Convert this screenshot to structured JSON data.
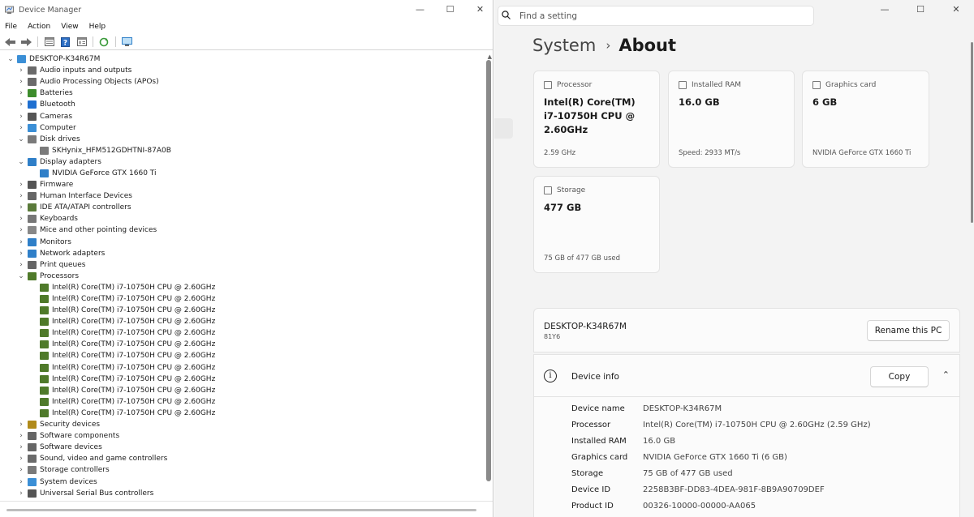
{
  "device_manager": {
    "title": "Device Manager",
    "window_controls": {
      "minimize": "—",
      "maximize": "☐",
      "close": "✕"
    },
    "menu": [
      "File",
      "Action",
      "View",
      "Help"
    ],
    "root": "DESKTOP-K34R67M",
    "tree": [
      {
        "label": "Audio inputs and outputs",
        "expanded": false,
        "icon": "speaker-icon",
        "color": "#6a6a6a"
      },
      {
        "label": "Audio Processing Objects (APOs)",
        "expanded": false,
        "icon": "speaker-icon",
        "color": "#6a6a6a"
      },
      {
        "label": "Batteries",
        "expanded": false,
        "icon": "battery-icon",
        "color": "#3d8c2c"
      },
      {
        "label": "Bluetooth",
        "expanded": false,
        "icon": "bluetooth-icon",
        "color": "#1e6fd0"
      },
      {
        "label": "Cameras",
        "expanded": false,
        "icon": "camera-icon",
        "color": "#555555"
      },
      {
        "label": "Computer",
        "expanded": false,
        "icon": "computer-icon",
        "color": "#3b8fd6"
      },
      {
        "label": "Disk drives",
        "expanded": true,
        "icon": "disk-icon",
        "color": "#7a7a7a",
        "children": [
          {
            "label": "SKHynix_HFM512GDHTNI-87A0B",
            "icon": "disk-icon",
            "color": "#7a7a7a"
          }
        ]
      },
      {
        "label": "Display adapters",
        "expanded": true,
        "icon": "monitor-icon",
        "color": "#2f7fc8",
        "children": [
          {
            "label": "NVIDIA GeForce GTX 1660 Ti",
            "icon": "monitor-icon",
            "color": "#2f7fc8"
          }
        ]
      },
      {
        "label": "Firmware",
        "expanded": false,
        "icon": "chip-icon",
        "color": "#555555"
      },
      {
        "label": "Human Interface Devices",
        "expanded": false,
        "icon": "hid-icon",
        "color": "#666666"
      },
      {
        "label": "IDE ATA/ATAPI controllers",
        "expanded": false,
        "icon": "controller-icon",
        "color": "#5a7a3a"
      },
      {
        "label": "Keyboards",
        "expanded": false,
        "icon": "keyboard-icon",
        "color": "#777777"
      },
      {
        "label": "Mice and other pointing devices",
        "expanded": false,
        "icon": "mouse-icon",
        "color": "#888888"
      },
      {
        "label": "Monitors",
        "expanded": false,
        "icon": "monitor-icon",
        "color": "#2f7fc8"
      },
      {
        "label": "Network adapters",
        "expanded": false,
        "icon": "network-icon",
        "color": "#2f7fc8"
      },
      {
        "label": "Print queues",
        "expanded": false,
        "icon": "printer-icon",
        "color": "#666666"
      },
      {
        "label": "Processors",
        "expanded": true,
        "icon": "processor-icon",
        "color": "#4f7a2a",
        "children": [
          {
            "label": "Intel(R) Core(TM) i7-10750H CPU @ 2.60GHz",
            "icon": "processor-icon",
            "color": "#4f7a2a"
          },
          {
            "label": "Intel(R) Core(TM) i7-10750H CPU @ 2.60GHz",
            "icon": "processor-icon",
            "color": "#4f7a2a"
          },
          {
            "label": "Intel(R) Core(TM) i7-10750H CPU @ 2.60GHz",
            "icon": "processor-icon",
            "color": "#4f7a2a"
          },
          {
            "label": "Intel(R) Core(TM) i7-10750H CPU @ 2.60GHz",
            "icon": "processor-icon",
            "color": "#4f7a2a"
          },
          {
            "label": "Intel(R) Core(TM) i7-10750H CPU @ 2.60GHz",
            "icon": "processor-icon",
            "color": "#4f7a2a"
          },
          {
            "label": "Intel(R) Core(TM) i7-10750H CPU @ 2.60GHz",
            "icon": "processor-icon",
            "color": "#4f7a2a"
          },
          {
            "label": "Intel(R) Core(TM) i7-10750H CPU @ 2.60GHz",
            "icon": "processor-icon",
            "color": "#4f7a2a"
          },
          {
            "label": "Intel(R) Core(TM) i7-10750H CPU @ 2.60GHz",
            "icon": "processor-icon",
            "color": "#4f7a2a"
          },
          {
            "label": "Intel(R) Core(TM) i7-10750H CPU @ 2.60GHz",
            "icon": "processor-icon",
            "color": "#4f7a2a"
          },
          {
            "label": "Intel(R) Core(TM) i7-10750H CPU @ 2.60GHz",
            "icon": "processor-icon",
            "color": "#4f7a2a"
          },
          {
            "label": "Intel(R) Core(TM) i7-10750H CPU @ 2.60GHz",
            "icon": "processor-icon",
            "color": "#4f7a2a"
          },
          {
            "label": "Intel(R) Core(TM) i7-10750H CPU @ 2.60GHz",
            "icon": "processor-icon",
            "color": "#4f7a2a"
          }
        ]
      },
      {
        "label": "Security devices",
        "expanded": false,
        "icon": "security-icon",
        "color": "#b08a1a"
      },
      {
        "label": "Software components",
        "expanded": false,
        "icon": "component-icon",
        "color": "#666666"
      },
      {
        "label": "Software devices",
        "expanded": false,
        "icon": "component-icon",
        "color": "#666666"
      },
      {
        "label": "Sound, video and game controllers",
        "expanded": false,
        "icon": "speaker-icon",
        "color": "#6a6a6a"
      },
      {
        "label": "Storage controllers",
        "expanded": false,
        "icon": "storage-controller-icon",
        "color": "#7a7a7a"
      },
      {
        "label": "System devices",
        "expanded": false,
        "icon": "computer-icon",
        "color": "#3b8fd6"
      },
      {
        "label": "Universal Serial Bus controllers",
        "expanded": false,
        "icon": "usb-icon",
        "color": "#555555"
      }
    ]
  },
  "settings": {
    "search_placeholder": "Find a setting",
    "window_controls": {
      "minimize": "—",
      "maximize": "☐",
      "close": "✕"
    },
    "breadcrumb": {
      "parent": "System",
      "separator": "›",
      "current": "About"
    },
    "cards": {
      "processor": {
        "title": "Processor",
        "value": "Intel(R) Core(TM) i7-10750H CPU @ 2.60GHz",
        "sub": "2.59 GHz"
      },
      "ram": {
        "title": "Installed RAM",
        "value": "16.0 GB",
        "sub": "Speed: 2933 MT/s"
      },
      "graphics": {
        "title": "Graphics card",
        "value": "6 GB",
        "sub": "NVIDIA GeForce GTX 1660 Ti"
      },
      "storage": {
        "title": "Storage",
        "value": "477 GB",
        "sub": "75 GB of 477 GB used"
      }
    },
    "pc": {
      "name": "DESKTOP-K34R67M",
      "model": "81Y6",
      "rename_label": "Rename this PC"
    },
    "device_info": {
      "title": "Device info",
      "copy_label": "Copy",
      "rows": [
        {
          "key": "Device name",
          "value": "DESKTOP-K34R67M"
        },
        {
          "key": "Processor",
          "value": "Intel(R) Core(TM) i7-10750H CPU @ 2.60GHz (2.59 GHz)"
        },
        {
          "key": "Installed RAM",
          "value": "16.0 GB"
        },
        {
          "key": "Graphics card",
          "value": "NVIDIA GeForce GTX 1660 Ti (6 GB)"
        },
        {
          "key": "Storage",
          "value": "75 GB of 477 GB used"
        },
        {
          "key": "Device ID",
          "value": "2258B3BF-DD83-4DEA-981F-8B9A90709DEF"
        },
        {
          "key": "Product ID",
          "value": "00326-10000-00000-AA065"
        }
      ]
    }
  }
}
